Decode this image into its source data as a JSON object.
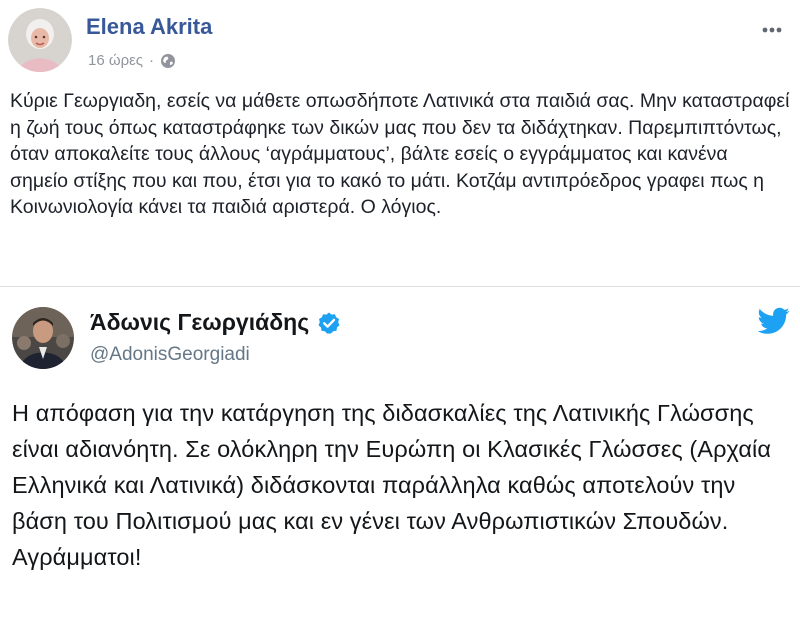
{
  "post": {
    "author": "Elena Akrita",
    "time": "16 ώρες",
    "separator": "·",
    "text": "Κύριε Γεωργιαδη, εσείς να μάθετε οπωσδήποτε Λατινικά στα παιδιά σας. Μην καταστραφεί η ζωή τους όπως καταστράφηκε των δικών μας που δεν τα διδάχτηκαν. Παρεμπιπτόντως, όταν αποκαλείτε τους άλλους ‘αγράμματους’, βάλτε εσείς ο εγγράμματος και κανένα σημείο στίξης που και που, έτσι για το κακό το μάτι. Κοτζάμ αντιπρόεδρος γραφει πως η Κοινωνιολογία κάνει τα παιδιά αριστερά. Ο λόγιος."
  },
  "tweet": {
    "name": "Άδωνις Γεωργιάδης",
    "handle": "@AdonisGeorgiadi",
    "text": "Η απόφαση για την κατάργηση της διδασκαλίες της Λατινικής Γλώσσης είναι αδιανόητη. Σε ολόκληρη την Ευρώπη οι Κλασικές Γλώσσες (Αρχαία Ελληνικά και Λατινικά) διδάσκονται παράλληλα καθώς αποτελούν την βάση του Πολιτισμού μας και εν γένει των Ανθρωπιστικών Σπουδών. Αγράμματοι!"
  },
  "icons": {
    "privacy": "globe-icon",
    "menu": "more-options-icon",
    "verified": "verified-badge-icon",
    "brand": "twitter-bird-icon"
  },
  "colors": {
    "author_link": "#385898",
    "meta_gray": "#90949c",
    "twitter_blue": "#1da1f2",
    "handle_gray": "#657786"
  }
}
